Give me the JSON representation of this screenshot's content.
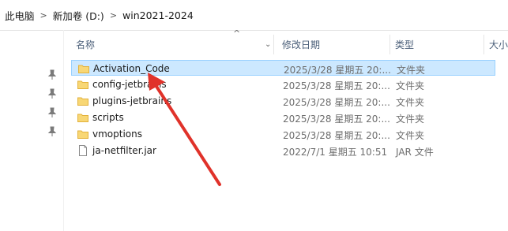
{
  "address_bar": {
    "crumbs": [
      "此电脑",
      "新加卷 (D:)",
      "win2021-2024"
    ],
    "separator": ">"
  },
  "columns": {
    "name": "名称",
    "date": "修改日期",
    "type": "类型",
    "size": "大小"
  },
  "files": [
    {
      "name": "Activation_Code",
      "date": "2025/3/28 星期五 20:...",
      "type": "文件夹",
      "icon": "folder-icon",
      "selected": true
    },
    {
      "name": "config-jetbrains",
      "date": "2025/3/28 星期五 20:...",
      "type": "文件夹",
      "icon": "folder-icon"
    },
    {
      "name": "plugins-jetbrains",
      "date": "2025/3/28 星期五 20:...",
      "type": "文件夹",
      "icon": "folder-icon"
    },
    {
      "name": "scripts",
      "date": "2025/3/28 星期五 20:...",
      "type": "文件夹",
      "icon": "folder-icon"
    },
    {
      "name": "vmoptions",
      "date": "2025/3/28 星期五 20:...",
      "type": "文件夹",
      "icon": "folder-icon"
    },
    {
      "name": "ja-netfilter.jar",
      "date": "2022/7/1 星期五 10:51",
      "type": "JAR 文件",
      "icon": "file-icon"
    }
  ],
  "colors": {
    "selection_bg": "#cce8ff",
    "selection_border": "#99d1ff",
    "folder": "#f8d775",
    "annotation_arrow": "#e0322a"
  }
}
